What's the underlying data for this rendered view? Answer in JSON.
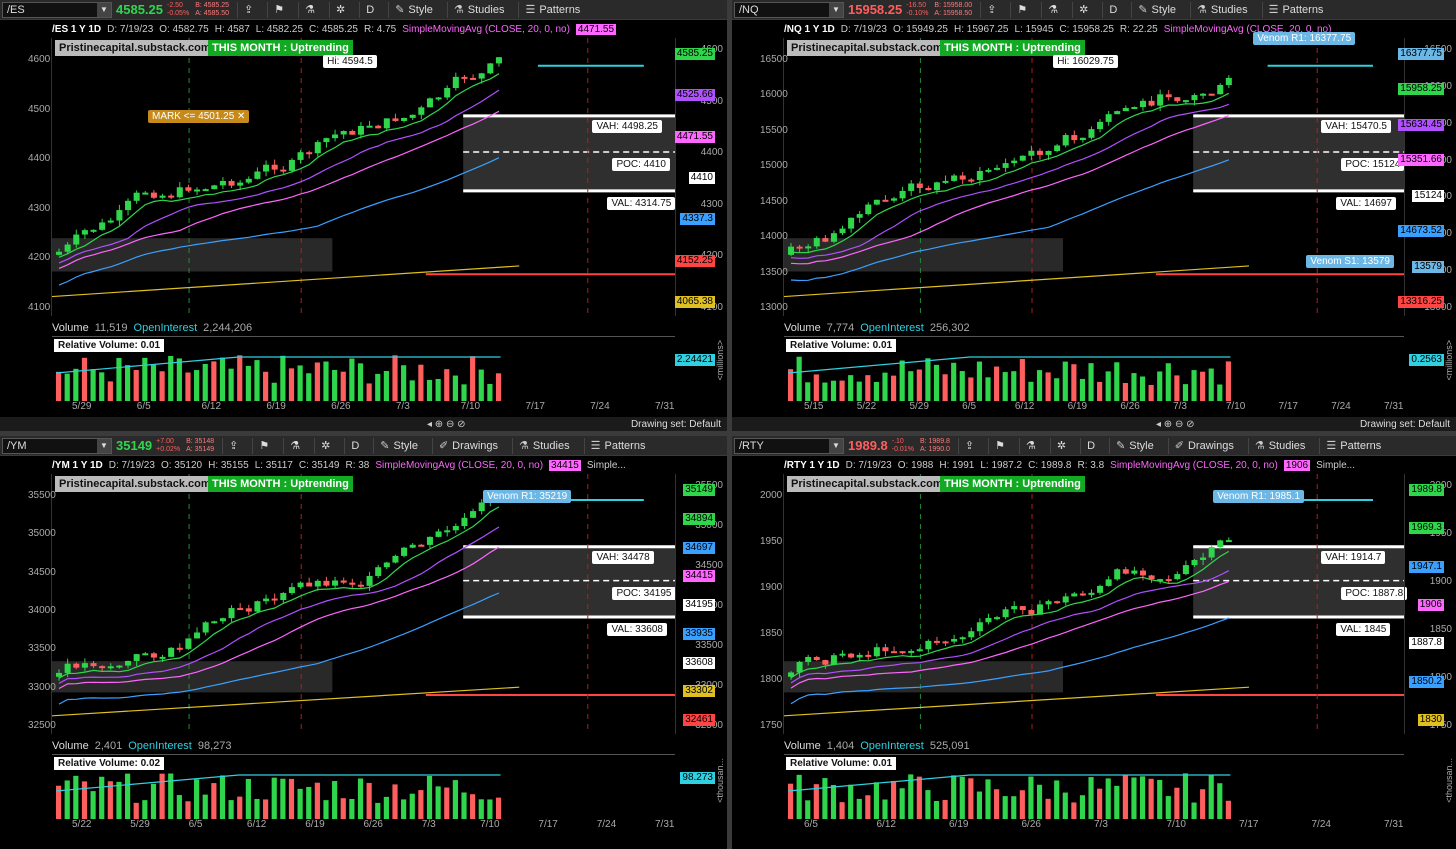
{
  "toolbar_buttons": {
    "style": "Style",
    "drawings": "Drawings",
    "studies": "Studies",
    "patterns": "Patterns",
    "period": "D"
  },
  "footer": {
    "drawing_set": "Drawing set: Default"
  },
  "panels": [
    {
      "id": "es",
      "symbol": "/ES",
      "last": "4585.25",
      "chg1": "-2.50",
      "chg2": "-0.05%",
      "bid": "B: 4585.25",
      "ask": "A: 4585.50",
      "last_color": "#2fd64c",
      "info": {
        "ticker": "/ES 1 Y 1D",
        "date": "D: 7/19/23",
        "open": "O: 4582.75",
        "high": "H: 4587",
        "low": "L: 4582.25",
        "close": "C: 4585.25",
        "range": "R: 4.75",
        "sma": "SimpleMovingAvg (CLOSE, 20, 0, no)",
        "sma_val": "4471.55",
        "extra": ""
      },
      "url": "Pristinecapital.substack.com",
      "trend": "THIS MONTH : Uptrending",
      "hi_label": "Hi: 4594.5",
      "mark_label": "MARK <= 4501.25 ✕",
      "vah": "VAH: 4498.25",
      "poc": "POC: 4410",
      "val": "VAL: 4314.75",
      "venom_r1": "",
      "venom_s1": "",
      "y_ticks": [
        "4600",
        "4500",
        "4400",
        "4300",
        "4200",
        "4100"
      ],
      "right_ticks": [
        "4600",
        "4500",
        "4400",
        "4300",
        "4200",
        "4100"
      ],
      "price_tags": [
        {
          "v": "4585.25",
          "c": "#2fd64c"
        },
        {
          "v": "4525.66",
          "c": "#b050ff"
        },
        {
          "v": "4471.55",
          "c": "#ff66ff"
        },
        {
          "v": "4410",
          "c": "#ffffff"
        },
        {
          "v": "4337.3",
          "c": "#3aa0ff"
        },
        {
          "v": "4152.25",
          "c": "#ff4444"
        },
        {
          "v": "4065.38",
          "c": "#e0c020"
        }
      ],
      "vol": {
        "label": "Volume",
        "volume": "11,519",
        "oi_label": "OpenInterest",
        "oi": "2,244,206",
        "rel": "Relative Volume: 0.01",
        "side_tag": "2.24421",
        "side_unit": "<millions>"
      },
      "dates": [
        "5/29",
        "6/5",
        "6/12",
        "6/19",
        "6/26",
        "7/3",
        "7/10",
        "7/17",
        "7/24",
        "7/31"
      ]
    },
    {
      "id": "nq",
      "symbol": "/NQ",
      "last": "15958.25",
      "chg1": "-16.50",
      "chg2": "-0.10%",
      "bid": "B: 15958.00",
      "ask": "A: 15958.50",
      "last_color": "#ff5e5e",
      "info": {
        "ticker": "/NQ 1 Y 1D",
        "date": "D: 7/19/23",
        "open": "O: 15949.25",
        "high": "H: 15967.25",
        "low": "L: 15945",
        "close": "C: 15958.25",
        "range": "R: 22.25",
        "sma": "SimpleMovingAvg (CLOSE, 20, 0, no)",
        "sma_val": "",
        "extra": ""
      },
      "url": "Pristinecapital.substack.com",
      "trend": "THIS MONTH : Uptrending",
      "hi_label": "Hi: 16029.75",
      "mark_label": "",
      "vah": "VAH: 15470.5",
      "poc": "POC: 15124",
      "val": "VAL: 14697",
      "venom_r1": "Venom R1: 16377.75",
      "venom_s1": "Venom S1: 13579",
      "y_ticks": [
        "16500",
        "16000",
        "15500",
        "15000",
        "14500",
        "14000",
        "13500",
        "13000"
      ],
      "right_ticks": [
        "16500",
        "16000",
        "15500",
        "15000",
        "14500",
        "14000",
        "13500",
        "13000"
      ],
      "price_tags": [
        {
          "v": "16377.75",
          "c": "#6bb7e6"
        },
        {
          "v": "15958.25",
          "c": "#2fd64c"
        },
        {
          "v": "15634.45",
          "c": "#b050ff"
        },
        {
          "v": "15351.66",
          "c": "#ff66ff"
        },
        {
          "v": "15124",
          "c": "#ffffff"
        },
        {
          "v": "14673.52",
          "c": "#3aa0ff"
        },
        {
          "v": "13579",
          "c": "#6bb7e6"
        },
        {
          "v": "13316.25",
          "c": "#ff4444"
        }
      ],
      "vol": {
        "label": "Volume",
        "volume": "7,774",
        "oi_label": "OpenInterest",
        "oi": "256,302",
        "rel": "Relative Volume: 0.01",
        "side_tag": "0.2563",
        "side_unit": "<millions>"
      },
      "dates": [
        "5/15",
        "5/22",
        "5/29",
        "6/5",
        "6/12",
        "6/19",
        "6/26",
        "7/3",
        "7/10",
        "7/17",
        "7/24",
        "7/31"
      ]
    },
    {
      "id": "ym",
      "symbol": "/YM",
      "last": "35149",
      "chg1": "+7.00",
      "chg2": "+0.02%",
      "bid": "B: 35148",
      "ask": "A: 35149",
      "last_color": "#2fd64c",
      "info": {
        "ticker": "/YM 1 Y 1D",
        "date": "D: 7/19/23",
        "open": "O: 35120",
        "high": "H: 35155",
        "low": "L: 35117",
        "close": "C: 35149",
        "range": "R: 38",
        "sma": "SimpleMovingAvg (CLOSE, 20, 0, no)",
        "sma_val": "34415",
        "extra": "Simple..."
      },
      "url": "Pristinecapital.substack.com",
      "trend": "THIS MONTH : Uptrending",
      "hi_label": "",
      "mark_label": "",
      "vah": "VAH: 34478",
      "poc": "POC: 34195",
      "val": "VAL: 33608",
      "venom_r1": "Venom R1: 35219",
      "venom_s1": "",
      "y_ticks": [
        "35500",
        "35000",
        "34500",
        "34000",
        "33500",
        "33000",
        "32500"
      ],
      "right_ticks": [
        "35500",
        "35000",
        "34500",
        "34000",
        "33500",
        "33000",
        "32500"
      ],
      "price_tags": [
        {
          "v": "35149",
          "c": "#2fd64c"
        },
        {
          "v": "34894",
          "c": "#2fd64c"
        },
        {
          "v": "34697",
          "c": "#3aa0ff"
        },
        {
          "v": "34415",
          "c": "#ff66ff"
        },
        {
          "v": "34195",
          "c": "#ffffff"
        },
        {
          "v": "33935",
          "c": "#3aa0ff"
        },
        {
          "v": "33608",
          "c": "#ffffff"
        },
        {
          "v": "33302",
          "c": "#e0c020"
        },
        {
          "v": "32461",
          "c": "#ff4444"
        }
      ],
      "vol": {
        "label": "Volume",
        "volume": "2,401",
        "oi_label": "OpenInterest",
        "oi": "98,273",
        "rel": "Relative Volume: 0.02",
        "side_tag": "98.273",
        "side_unit": "<thousan..."
      },
      "dates": [
        "5/22",
        "5/29",
        "6/5",
        "6/12",
        "6/19",
        "6/26",
        "7/3",
        "7/10",
        "7/17",
        "7/24",
        "7/31"
      ]
    },
    {
      "id": "rty",
      "symbol": "/RTY",
      "last": "1989.8",
      "chg1": "-.10",
      "chg2": "-0.01%",
      "bid": "B: 1989.8",
      "ask": "A: 1990.0",
      "last_color": "#ff5e5e",
      "info": {
        "ticker": "/RTY 1 Y 1D",
        "date": "D: 7/19/23",
        "open": "O: 1988",
        "high": "H: 1991",
        "low": "L: 1987.2",
        "close": "C: 1989.8",
        "range": "R: 3.8",
        "sma": "SimpleMovingAvg (CLOSE, 20, 0, no)",
        "sma_val": "1906",
        "extra": "Simple..."
      },
      "url": "Pristinecapital.substack.com",
      "trend": "THIS MONTH : Uptrending",
      "hi_label": "",
      "mark_label": "",
      "vah": "VAH: 1914.7",
      "poc": "POC: 1887.8",
      "val": "VAL: 1845",
      "venom_r1": "Venom R1: 1985.1",
      "venom_s1": "",
      "y_ticks": [
        "2000",
        "1950",
        "1900",
        "1850",
        "1800",
        "1750"
      ],
      "right_ticks": [
        "2000",
        "1950",
        "1900",
        "1850",
        "1800",
        "1750"
      ],
      "price_tags": [
        {
          "v": "1989.8",
          "c": "#2fd64c"
        },
        {
          "v": "1969.3",
          "c": "#2fd64c"
        },
        {
          "v": "1947.1",
          "c": "#3aa0ff"
        },
        {
          "v": "1906",
          "c": "#ff66ff"
        },
        {
          "v": "1887.8",
          "c": "#ffffff"
        },
        {
          "v": "1850.2",
          "c": "#3aa0ff"
        },
        {
          "v": "1830",
          "c": "#e0c020"
        }
      ],
      "vol": {
        "label": "Volume",
        "volume": "1,404",
        "oi_label": "OpenInterest",
        "oi": "525,091",
        "rel": "Relative Volume: 0.01",
        "side_tag": "",
        "side_unit": "<thousan..."
      },
      "dates": [
        "6/5",
        "6/12",
        "6/19",
        "6/26",
        "7/3",
        "7/10",
        "7/17",
        "7/24",
        "7/31"
      ]
    }
  ]
}
